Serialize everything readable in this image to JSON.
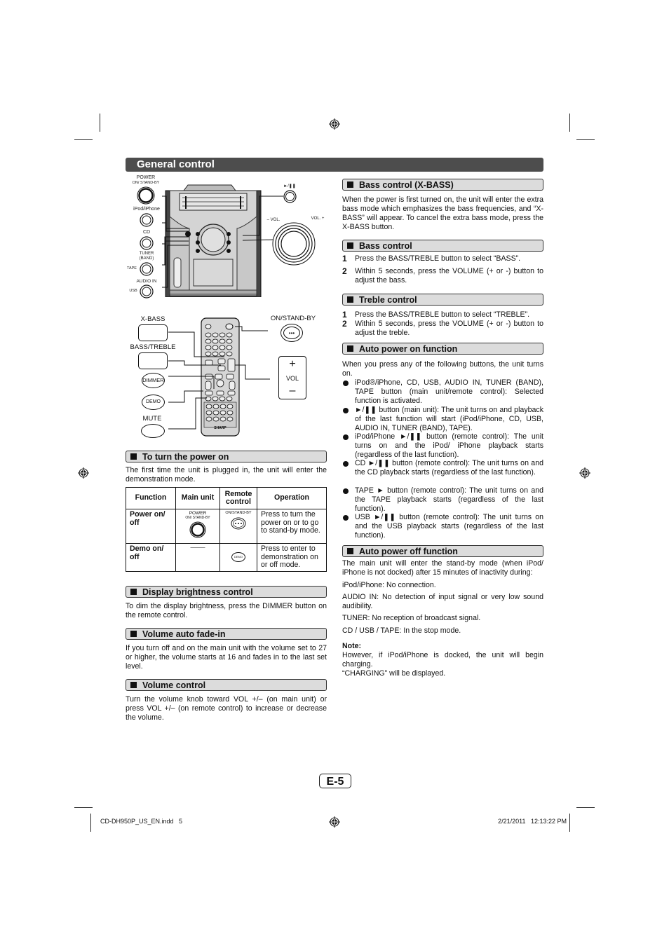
{
  "page": {
    "title": "General control",
    "page_number": "E-5",
    "footer_file": "CD-DH950P_US_EN.indd   5",
    "footer_timestamp": "2/21/2011   12:13:22 PM"
  },
  "illustration_main_unit": {
    "labels": {
      "power": "POWER",
      "power_sub": "ON/ STAND-BY",
      "ipod": "iPod/iPhone",
      "cd": "CD",
      "tuner": "TUNER\n(BAND)",
      "tape": "TAPE",
      "audio_in": "AUDIO IN",
      "usb": "USB",
      "play_pause": "►/❚❚",
      "vol_minus": "– VOL.",
      "vol_plus": "VOL. +"
    }
  },
  "illustration_remote": {
    "labels": {
      "x_bass": "X-BASS",
      "bass_treble": "BASS/TREBLE",
      "dimmer": "DIMMER",
      "demo": "DEMO",
      "mute": "MUTE",
      "on_standby": "ON/STAND-BY",
      "vol": "VOL",
      "vol_plus": "+",
      "vol_minus": "–",
      "brand": "SHARP"
    }
  },
  "left_column": {
    "power_on": {
      "heading": "To turn the power on",
      "text": "The first time the unit is plugged in, the unit will enter the demonstration mode.",
      "table": {
        "headers": [
          "Function",
          "Main unit",
          "Remote control",
          "Operation"
        ],
        "rows": [
          {
            "function": "Power on/ off",
            "main_unit_label": "POWER",
            "main_unit_sub": "ON/ STAND-BY",
            "remote_label": "ON/STAND-BY",
            "operation": "Press to turn the power on or to go to stand-by mode."
          },
          {
            "function": "Demo on/ off",
            "main_unit_label": "———",
            "remote_label": "DEMO",
            "operation": "Press to enter to demonstration on or off mode."
          }
        ]
      }
    },
    "display_brightness": {
      "heading": "Display brightness control",
      "text": "To dim the display brightness, press the DIMMER button on the remote control."
    },
    "volume_fade": {
      "heading": "Volume auto fade-in",
      "text": "If you turn off and on the main unit with the volume set to 27 or higher, the volume starts at 16 and fades in to the last set level."
    },
    "volume_control": {
      "heading": "Volume control",
      "text": "Turn the volume knob toward VOL +/– (on main unit) or press VOL +/– (on remote control) to increase or decrease the volume."
    }
  },
  "right_column": {
    "x_bass": {
      "heading": "Bass control (X-BASS)",
      "text": "When the power is first turned on, the unit will enter the extra bass mode which emphasizes the bass frequencies, and “X-BASS” will appear. To cancel the extra bass mode, press the X-BASS button."
    },
    "bass": {
      "heading": "Bass control",
      "steps": [
        {
          "num": "1",
          "text": "Press the BASS/TREBLE button to select “BASS”."
        },
        {
          "num": "2",
          "text": "Within 5 seconds, press the VOLUME (+ or -) button to adjust the bass."
        }
      ]
    },
    "treble": {
      "heading": "Treble control",
      "steps": [
        {
          "num": "1",
          "text": "Press the BASS/TREBLE button to select “TREBLE”."
        },
        {
          "num": "2",
          "text": "Within 5 seconds, press the VOLUME (+ or -) button to adjust the treble."
        }
      ]
    },
    "auto_on": {
      "heading": "Auto power on function",
      "intro": "When you press any of the following buttons, the unit turns on.",
      "bullets": [
        "iPod®/iPhone, CD, USB, AUDIO IN, TUNER (BAND), TAPE button (main unit/remote control): Selected function is activated.",
        "►/❚❚ button (main unit): The unit turns on and playback of the last function will start (iPod/iPhone, CD, USB, AUDIO IN, TUNER (BAND), TAPE).",
        "iPod/iPhone ►/❚❚ button (remote control): The unit turns on and the iPod/ iPhone playback starts (regardless of the last function).",
        "CD ►/❚❚ button (remote control): The unit turns on and the CD playback starts (regardless of the last function).",
        "TAPE ► button (remote control): The unit turns on and the TAPE playback starts (regardless of the last function).",
        "USB ►/❚❚ button (remote control): The unit turns on and the USB playback starts (regardless of the last function)."
      ]
    },
    "auto_off": {
      "heading": "Auto power off function",
      "text": "The main unit will enter the stand-by mode (when iPod/ iPhone is not docked) after 15 minutes of inactivity during:",
      "items": [
        "iPod/iPhone: No connection.",
        "AUDIO IN: No detection of input signal or very low sound audibility.",
        "TUNER: No reception of broadcast signal.",
        "CD / USB / TAPE: In the stop mode."
      ],
      "note_label": "Note:",
      "note_text": "However, if iPod/iPhone is docked, the unit will begin charging.",
      "note_text2": "“CHARGING” will be displayed."
    }
  }
}
